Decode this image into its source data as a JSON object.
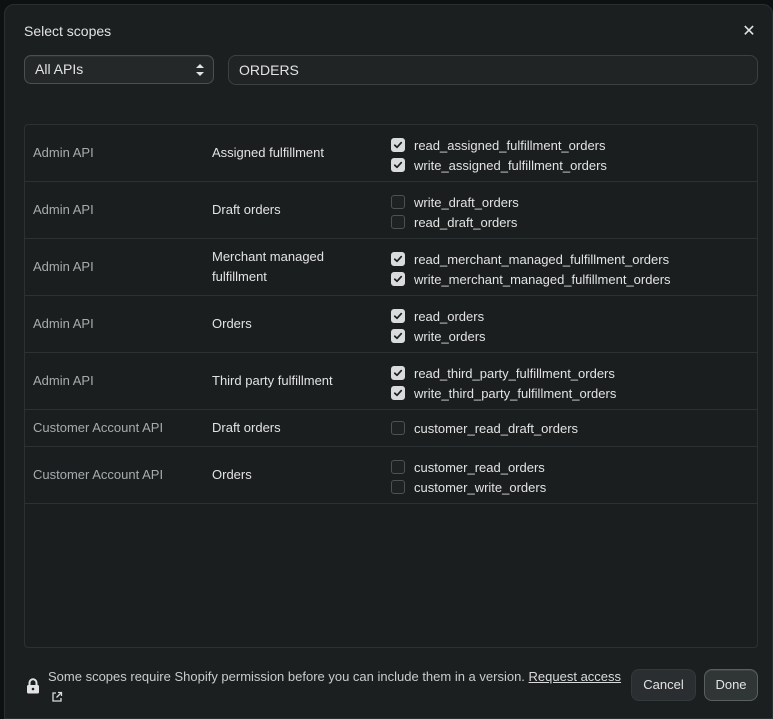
{
  "dialog": {
    "title": "Select scopes",
    "close_icon": "close-icon"
  },
  "filters": {
    "api_select_value": "All APIs",
    "search_value": "ORDERS"
  },
  "rows": [
    {
      "api": "Admin API",
      "resource": "Assigned fulfillment",
      "scopes": [
        {
          "name": "read_assigned_fulfillment_orders",
          "checked": true
        },
        {
          "name": "write_assigned_fulfillment_orders",
          "checked": true
        }
      ]
    },
    {
      "api": "Admin API",
      "resource": "Draft orders",
      "scopes": [
        {
          "name": "write_draft_orders",
          "checked": false
        },
        {
          "name": "read_draft_orders",
          "checked": false
        }
      ]
    },
    {
      "api": "Admin API",
      "resource": "Merchant managed fulfillment",
      "scopes": [
        {
          "name": "read_merchant_managed_fulfillment_orders",
          "checked": true
        },
        {
          "name": "write_merchant_managed_fulfillment_orders",
          "checked": true
        }
      ]
    },
    {
      "api": "Admin API",
      "resource": "Orders",
      "scopes": [
        {
          "name": "read_orders",
          "checked": true
        },
        {
          "name": "write_orders",
          "checked": true
        }
      ]
    },
    {
      "api": "Admin API",
      "resource": "Third party fulfillment",
      "scopes": [
        {
          "name": "read_third_party_fulfillment_orders",
          "checked": true
        },
        {
          "name": "write_third_party_fulfillment_orders",
          "checked": true
        }
      ]
    },
    {
      "api": "Customer Account API",
      "resource": "Draft orders",
      "scopes": [
        {
          "name": "customer_read_draft_orders",
          "checked": false
        }
      ]
    },
    {
      "api": "Customer Account API",
      "resource": "Orders",
      "scopes": [
        {
          "name": "customer_read_orders",
          "checked": false
        },
        {
          "name": "customer_write_orders",
          "checked": false
        }
      ]
    }
  ],
  "footer": {
    "notice": "Some scopes require Shopify permission before you can include them in a version.",
    "link_text": "Request access",
    "cancel_label": "Cancel",
    "done_label": "Done"
  },
  "colors": {
    "background": "#1b1f20",
    "checkbox_checked": "#d9dbdc",
    "text": "#e3e3e3",
    "muted_text": "#a8abad"
  }
}
